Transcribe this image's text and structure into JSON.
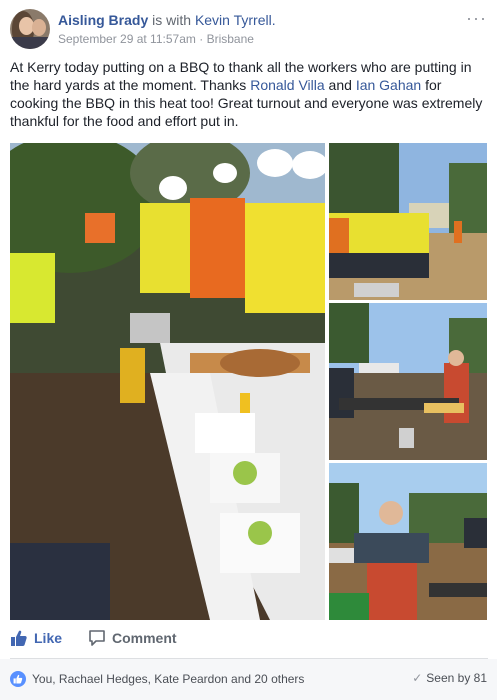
{
  "header": {
    "author": "Aisling Brady",
    "with_text": "is with",
    "tagged": "Kevin Tyrrell.",
    "date": "September 29 at 11:57am",
    "separator": "·",
    "location": "Brisbane",
    "more_glyph": "···"
  },
  "post": {
    "text_1": "At Kerry today putting on a BBQ to thank all the workers who are putting in the hard yards at the moment. Thanks ",
    "mention_1": "Ronald Villa",
    "text_2": " and ",
    "mention_2": "Ian Gahan",
    "text_3": " for cooking the BBQ in this heat too! Great turnout and everyone was extremely thankful for the food and effort put in."
  },
  "actions": {
    "like_label": "Like",
    "comment_label": "Comment"
  },
  "footer": {
    "reactions_text": "You, Rachael Hedges, Kate Peardon and 20 others",
    "seen_text": "Seen by 81"
  },
  "colors": {
    "link": "#365899",
    "like_blue": "#4267b2",
    "meta_gray": "#90949c",
    "footer_bg": "#f6f7f9"
  },
  "icons": {
    "like": "thumbs-up-icon",
    "comment": "speech-bubble-icon",
    "seen": "checkmark-icon",
    "more": "ellipsis-icon"
  }
}
